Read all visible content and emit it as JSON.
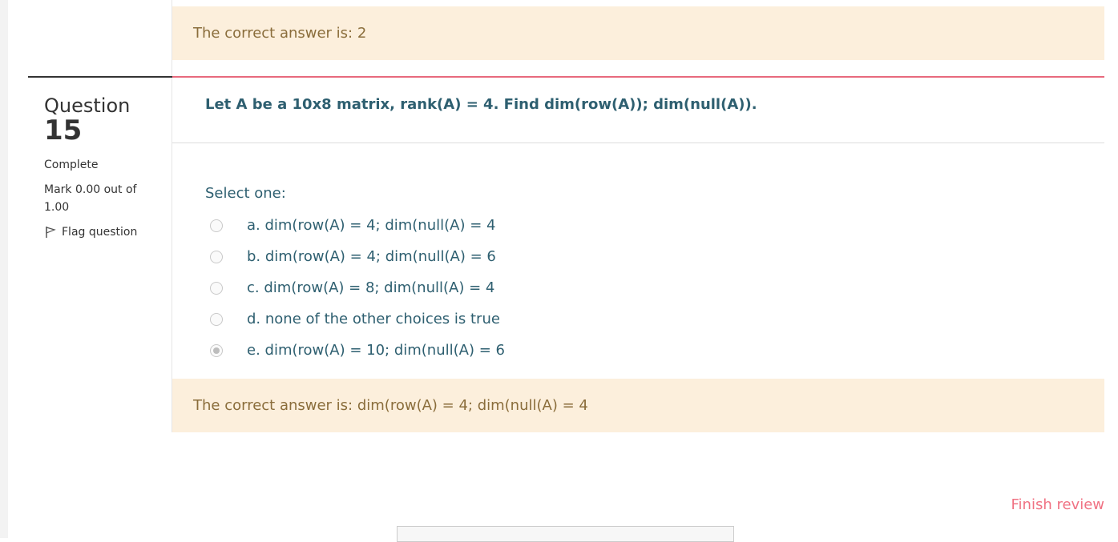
{
  "previous_question": {
    "correct_answer_text": "The correct answer is: 2"
  },
  "question": {
    "label": "Question",
    "number": "15",
    "state": "Complete",
    "grade": "Mark 0.00 out of 1.00",
    "flag_label": "Flag question",
    "text": "Let A be a 10x8 matrix, rank(A) = 4. Find dim(row(A)); dim(null(A)).",
    "prompt": "Select one:",
    "options": [
      {
        "label": "a. dim(row(A) = 4; dim(null(A) = 4",
        "selected": false
      },
      {
        "label": "b. dim(row(A) = 4; dim(null(A) = 6",
        "selected": false
      },
      {
        "label": "c. dim(row(A) = 8; dim(null(A) = 4",
        "selected": false
      },
      {
        "label": "d. none of the other choices is true",
        "selected": false
      },
      {
        "label": "e. dim(row(A) = 10; dim(null(A) = 6",
        "selected": true
      }
    ],
    "correct_answer_text": "The correct answer is: dim(row(A) = 4; dim(null(A) = 4"
  },
  "navigation": {
    "finish_review_label": "Finish review"
  },
  "colors": {
    "feedback_bg": "#fcefdc",
    "feedback_text": "#8a6d3b",
    "question_text": "#2e5f70",
    "accent_rule": "#e86a7d",
    "link": "#f07283"
  },
  "icons": {
    "flag": "flag-icon"
  }
}
